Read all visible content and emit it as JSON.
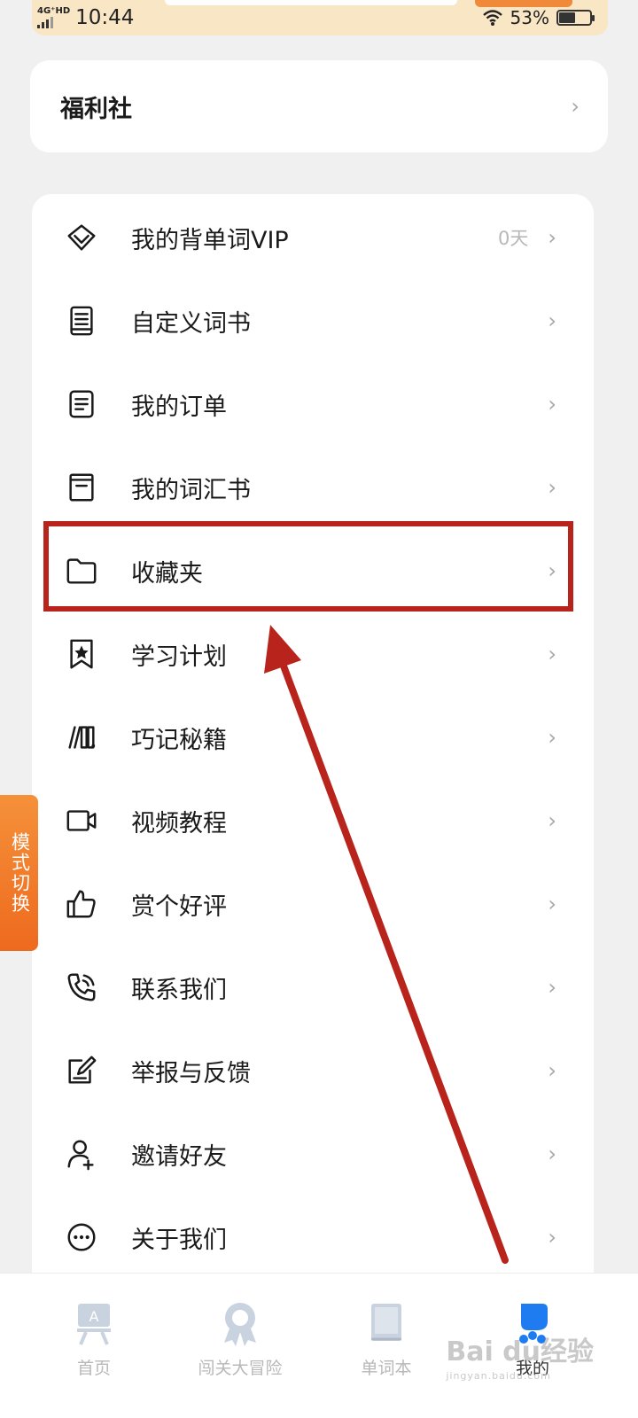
{
  "status_bar": {
    "network": "4G⁺HD",
    "time": "10:44",
    "battery_percent": "53%",
    "battery_level": 0.53
  },
  "welfare": {
    "title": "福利社"
  },
  "menu": {
    "items": [
      {
        "label": "我的背单词VIP",
        "extra": "0天",
        "icon": "diamond-icon"
      },
      {
        "label": "自定义词书",
        "extra": "",
        "icon": "notebook-icon"
      },
      {
        "label": "我的订单",
        "extra": "",
        "icon": "document-icon"
      },
      {
        "label": "我的词汇书",
        "extra": "",
        "icon": "book-icon"
      },
      {
        "label": "收藏夹",
        "extra": "",
        "icon": "folder-icon"
      },
      {
        "label": "学习计划",
        "extra": "",
        "icon": "bookmark-star-icon"
      },
      {
        "label": "巧记秘籍",
        "extra": "",
        "icon": "books-icon"
      },
      {
        "label": "视频教程",
        "extra": "",
        "icon": "video-camera-icon"
      },
      {
        "label": "赏个好评",
        "extra": "",
        "icon": "thumbs-up-icon"
      },
      {
        "label": "联系我们",
        "extra": "",
        "icon": "phone-icon"
      },
      {
        "label": "举报与反馈",
        "extra": "",
        "icon": "edit-icon"
      },
      {
        "label": "邀请好友",
        "extra": "",
        "icon": "add-user-icon"
      },
      {
        "label": "关于我们",
        "extra": "",
        "icon": "more-circle-icon"
      }
    ]
  },
  "mode_tab": {
    "label": "模式切换"
  },
  "bottom_nav": {
    "items": [
      {
        "label": "首页",
        "icon": "home-board-icon",
        "active": false
      },
      {
        "label": "闯关大冒险",
        "icon": "medal-icon",
        "active": false
      },
      {
        "label": "单词本",
        "icon": "wordbook-icon",
        "active": false
      },
      {
        "label": "我的",
        "icon": "profile-icon",
        "active": true
      }
    ]
  },
  "watermark": {
    "text": "Bai du经验",
    "sub": "jingyan.baidu.com"
  },
  "colors": {
    "accent_orange": "#ee6a1e",
    "highlight_red": "#b8241c",
    "active_blue": "#1e7bf0"
  }
}
